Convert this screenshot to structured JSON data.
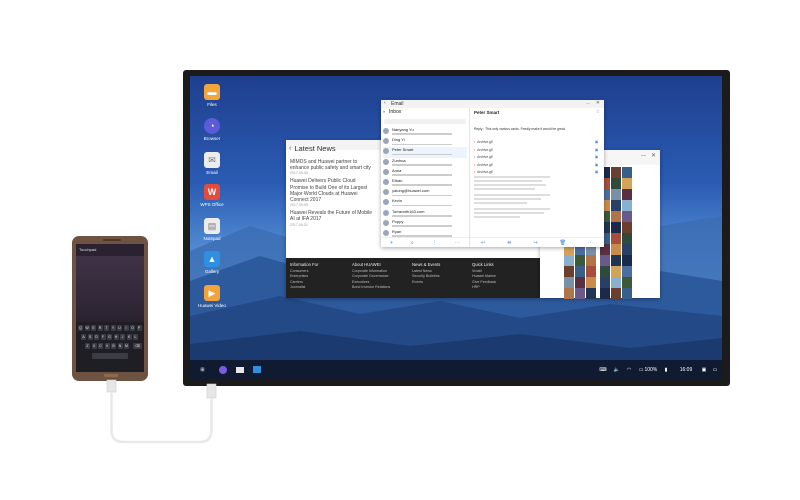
{
  "desktop": {
    "icons": [
      {
        "label": "Files",
        "icon": "folder-icon",
        "color": "#f2a53a"
      },
      {
        "label": "Browser",
        "icon": "browser-icon",
        "color": "#5b5bd6"
      },
      {
        "label": "Email",
        "icon": "email-icon",
        "color": "#e8e8e8"
      },
      {
        "label": "WPS Office",
        "icon": "wps-office-icon",
        "color": "#e44b3c"
      },
      {
        "label": "Notepad",
        "icon": "notepad-icon",
        "color": "#e8e8e8"
      },
      {
        "label": "Gallery",
        "icon": "gallery-icon",
        "color": "#2f8fe0"
      },
      {
        "label": "Huawei Video",
        "icon": "video-icon",
        "color": "#f4a33a"
      }
    ]
  },
  "news_window": {
    "title": "Latest News",
    "items": [
      {
        "headline": "MIMDS and Huawei partner to enhance public safety and smart city",
        "date": "2017-09-06"
      },
      {
        "headline": "Huawei Delivers Public Cloud Promise to Build One of its Largest Major World Clouds at Huawei Connect 2017",
        "date": "2017-09-05"
      },
      {
        "headline": "Huawei Reveals the Future of Mobile AI at IFA 2017",
        "date": "2017-09-02"
      }
    ],
    "footer": {
      "columns": [
        {
          "heading": "Information For",
          "links": [
            "Consumers",
            "Enterprises",
            "Carriers",
            "Journalist"
          ]
        },
        {
          "heading": "About HUAWEI",
          "links": [
            "Corporate Information",
            "Corporate Governance",
            "Executives",
            "Bond Investor Relations"
          ]
        },
        {
          "heading": "News & Events",
          "links": [
            "Latest News",
            "Security Bulletins",
            "Events"
          ]
        },
        {
          "heading": "Quick Links",
          "links": [
            "VmallI",
            "Huawei Marine",
            "Give Feedback",
            "HRP"
          ]
        }
      ]
    }
  },
  "email_window": {
    "title": "Email",
    "folder": "Inbox",
    "subject_sender": "Peter Smart",
    "reply_line": "Reply : This only various cards. Feedly make it would be great.",
    "list": [
      {
        "name": "Nanyang Yu"
      },
      {
        "name": "Ding Yi"
      },
      {
        "name": "Peter Smart"
      },
      {
        "name": "Zunhua"
      },
      {
        "name": "Anna"
      },
      {
        "name": "Ethan"
      },
      {
        "name": "yatong@huawei.com"
      },
      {
        "name": "Kevin"
      },
      {
        "name": "Tomsmith163.com"
      },
      {
        "name": "Poppy"
      },
      {
        "name": "Ryan"
      }
    ],
    "attachments": [
      {
        "name": "Archive.gif"
      },
      {
        "name": "Archive.gif"
      },
      {
        "name": "Archive.gif"
      },
      {
        "name": "Archive.gif"
      },
      {
        "name": "Archive.gif"
      }
    ]
  },
  "taskbar": {
    "battery": "100%",
    "time": "16:09"
  },
  "phone": {
    "app_title": "Touchpad",
    "keyboard_rows": [
      [
        "Q",
        "W",
        "E",
        "R",
        "T",
        "Y",
        "U",
        "I",
        "O",
        "P"
      ],
      [
        "A",
        "S",
        "D",
        "F",
        "G",
        "H",
        "J",
        "K",
        "L"
      ],
      [
        "Z",
        "X",
        "C",
        "V",
        "B",
        "N",
        "M"
      ]
    ]
  }
}
